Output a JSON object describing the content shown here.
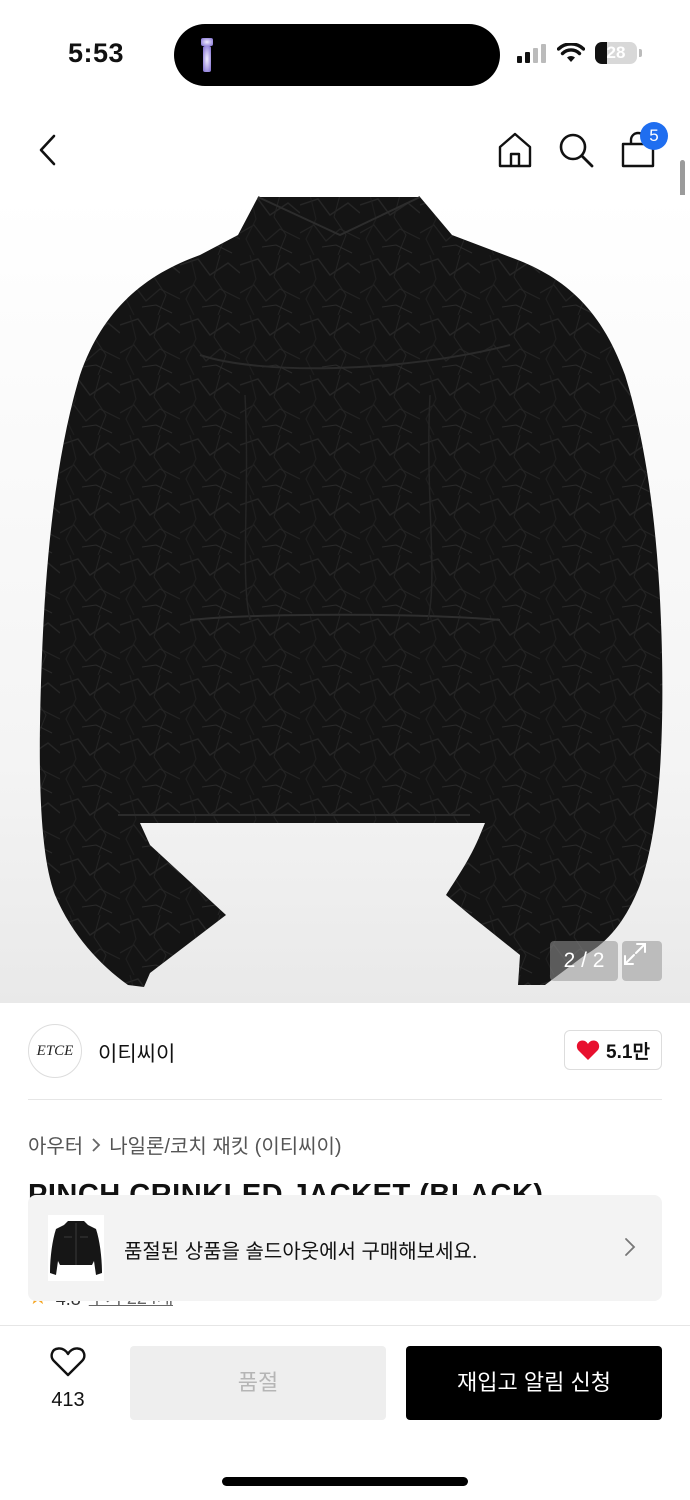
{
  "status_bar": {
    "time": "5:53",
    "battery_level": "28",
    "battery_fraction": 0.28
  },
  "header": {
    "cart_count": "5"
  },
  "gallery": {
    "counter": "2 / 2",
    "image_alt": "black crinkled jacket back view"
  },
  "brand": {
    "logo_text": "ETCE",
    "name": "이티씨이",
    "like_count": "5.1만"
  },
  "breadcrumb": {
    "items": [
      "아우터",
      "나일론/코치 재킷 (이티씨이)"
    ]
  },
  "product": {
    "title": "PINCH CRINKLED JACKET (BLACK)",
    "rating": "4.8",
    "review_link": "후기 224개"
  },
  "soldout_banner": {
    "message": "품절된 상품을 솔드아웃에서 구매해보세요."
  },
  "bottom_bar": {
    "wish_count": "413",
    "soldout_label": "품절",
    "restock_label": "재입고 알림 신청"
  },
  "colors": {
    "accent_badge": "#1f6ef0",
    "heart": "#e8102e",
    "primary_button": "#000000"
  }
}
